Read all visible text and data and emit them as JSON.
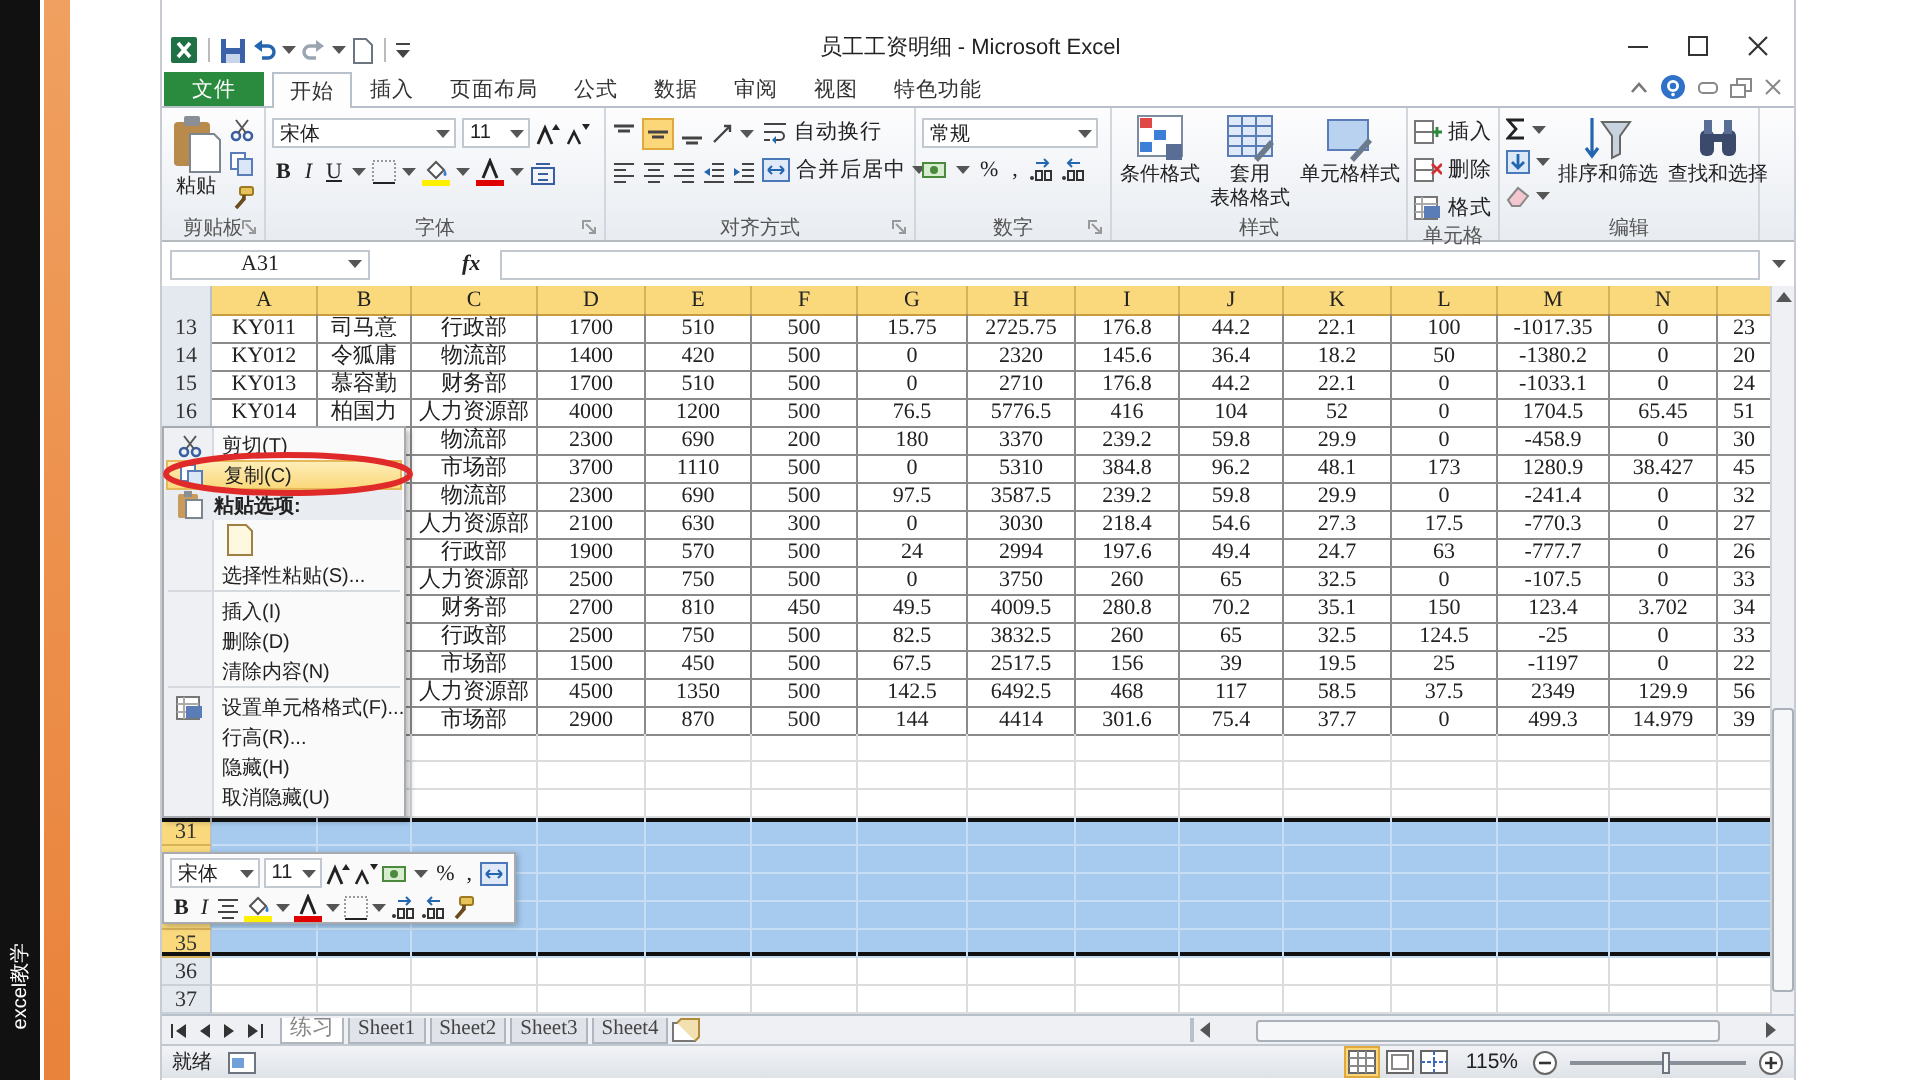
{
  "side_label": "excel教学",
  "window": {
    "title": "员工工资明细 - Microsoft Excel"
  },
  "ribbon_tabs": [
    {
      "label": "文件",
      "kind": "file",
      "selected": false
    },
    {
      "label": "开始",
      "kind": "tab",
      "selected": true
    },
    {
      "label": "插入",
      "kind": "tab",
      "selected": false
    },
    {
      "label": "页面布局",
      "kind": "tab",
      "selected": false
    },
    {
      "label": "公式",
      "kind": "tab",
      "selected": false
    },
    {
      "label": "数据",
      "kind": "tab",
      "selected": false
    },
    {
      "label": "审阅",
      "kind": "tab",
      "selected": false
    },
    {
      "label": "视图",
      "kind": "tab",
      "selected": false
    },
    {
      "label": "特色功能",
      "kind": "tab",
      "selected": false
    }
  ],
  "ribbon": {
    "clipboard": {
      "label": "剪贴板",
      "paste": "粘贴"
    },
    "font": {
      "label": "字体",
      "font_name": "宋体",
      "font_size": "11",
      "bold": "B",
      "italic": "I",
      "underline": "U"
    },
    "alignment": {
      "label": "对齐方式",
      "wrap": "自动换行",
      "merge": "合并后居中"
    },
    "number": {
      "label": "数字",
      "format": "常规",
      "percent": "%",
      "comma": ","
    },
    "styles": {
      "label": "样式",
      "buttons": [
        {
          "lines": [
            "条件格式"
          ]
        },
        {
          "lines": [
            "套用",
            "表格格式"
          ]
        },
        {
          "lines": [
            "单元格样式"
          ]
        }
      ]
    },
    "cells": {
      "label": "单元格",
      "items": [
        "插入",
        "删除",
        "格式"
      ]
    },
    "editing": {
      "label": "编辑",
      "buttons": [
        "排序和筛选",
        "查找和选择"
      ]
    }
  },
  "formula_bar": {
    "name_box": "A31",
    "fx": "fx"
  },
  "columns": [
    "A",
    "B",
    "C",
    "D",
    "E",
    "F",
    "G",
    "H",
    "I",
    "J",
    "K",
    "L",
    "M",
    "N"
  ],
  "rows": [
    {
      "number": "13",
      "selected": false,
      "cells": [
        "KY011",
        "司马意",
        "行政部",
        "1700",
        "510",
        "500",
        "15.75",
        "2725.75",
        "176.8",
        "44.2",
        "22.1",
        "100",
        "-1017.35",
        "0",
        "23"
      ]
    },
    {
      "number": "14",
      "selected": false,
      "cells": [
        "KY012",
        "令狐庸",
        "物流部",
        "1400",
        "420",
        "500",
        "0",
        "2320",
        "145.6",
        "36.4",
        "18.2",
        "50",
        "-1380.2",
        "0",
        "20"
      ]
    },
    {
      "number": "15",
      "selected": false,
      "cells": [
        "KY013",
        "慕容勤",
        "财务部",
        "1700",
        "510",
        "500",
        "0",
        "2710",
        "176.8",
        "44.2",
        "22.1",
        "0",
        "-1033.1",
        "0",
        "24"
      ]
    },
    {
      "number": "16",
      "selected": false,
      "cells": [
        "KY014",
        "柏国力",
        "人力资源部",
        "4000",
        "1200",
        "500",
        "76.5",
        "5776.5",
        "416",
        "104",
        "52",
        "0",
        "1704.5",
        "65.45",
        "51"
      ]
    },
    {
      "selected": false,
      "cells": [
        "物流部",
        "2300",
        "690",
        "200",
        "180",
        "3370",
        "239.2",
        "59.8",
        "29.9",
        "0",
        "-458.9",
        "0",
        "30"
      ]
    },
    {
      "selected": false,
      "cells": [
        "市场部",
        "3700",
        "1110",
        "500",
        "0",
        "5310",
        "384.8",
        "96.2",
        "48.1",
        "173",
        "1280.9",
        "38.427",
        "45"
      ]
    },
    {
      "selected": false,
      "cells": [
        "物流部",
        "2300",
        "690",
        "500",
        "97.5",
        "3587.5",
        "239.2",
        "59.8",
        "29.9",
        "0",
        "-241.4",
        "0",
        "32"
      ]
    },
    {
      "selected": false,
      "cells": [
        "人力资源部",
        "2100",
        "630",
        "300",
        "0",
        "3030",
        "218.4",
        "54.6",
        "27.3",
        "17.5",
        "-770.3",
        "0",
        "27"
      ]
    },
    {
      "selected": false,
      "cells": [
        "行政部",
        "1900",
        "570",
        "500",
        "24",
        "2994",
        "197.6",
        "49.4",
        "24.7",
        "63",
        "-777.7",
        "0",
        "26"
      ]
    },
    {
      "selected": false,
      "cells": [
        "人力资源部",
        "2500",
        "750",
        "500",
        "0",
        "3750",
        "260",
        "65",
        "32.5",
        "0",
        "-107.5",
        "0",
        "33"
      ]
    },
    {
      "selected": false,
      "cells": [
        "财务部",
        "2700",
        "810",
        "450",
        "49.5",
        "4009.5",
        "280.8",
        "70.2",
        "35.1",
        "150",
        "123.4",
        "3.702",
        "34"
      ]
    },
    {
      "selected": false,
      "cells": [
        "行政部",
        "2500",
        "750",
        "500",
        "82.5",
        "3832.5",
        "260",
        "65",
        "32.5",
        "124.5",
        "-25",
        "0",
        "33"
      ]
    },
    {
      "selected": false,
      "cells": [
        "市场部",
        "1500",
        "450",
        "500",
        "67.5",
        "2517.5",
        "156",
        "39",
        "19.5",
        "25",
        "-1197",
        "0",
        "22"
      ]
    },
    {
      "selected": false,
      "cells": [
        "人力资源部",
        "4500",
        "1350",
        "500",
        "142.5",
        "6492.5",
        "468",
        "117",
        "58.5",
        "37.5",
        "2349",
        "129.9",
        "56"
      ]
    },
    {
      "selected": false,
      "cells": [
        "市场部",
        "2900",
        "870",
        "500",
        "144",
        "4414",
        "301.6",
        "75.4",
        "37.7",
        "0",
        "499.3",
        "14.979",
        "39"
      ]
    },
    {
      "selected": false
    },
    {
      "selected": false
    },
    {
      "selected": false
    },
    {
      "number": "31",
      "selected": true
    },
    {
      "selected": true
    },
    {
      "selected": true
    },
    {
      "selected": true
    },
    {
      "number": "35",
      "selected": true
    },
    {
      "number": "36",
      "selected": false
    },
    {
      "number": "37",
      "selected": false
    }
  ],
  "context_menu": [
    {
      "kind": "cut",
      "label": "剪切(T)",
      "selected": false
    },
    {
      "kind": "copy",
      "label": "复制(C)",
      "selected": true
    },
    {
      "kind": "header",
      "label": "粘贴选项:",
      "selected": false
    },
    {
      "kind": "paste_button",
      "selected": false
    },
    {
      "kind": "item",
      "label": "选择性粘贴(S)...",
      "selected": false,
      "divider_below": true
    },
    {
      "kind": "item",
      "label": "插入(I)",
      "selected": false
    },
    {
      "kind": "item",
      "label": "删除(D)",
      "selected": false
    },
    {
      "kind": "item",
      "label": "清除内容(N)",
      "selected": false,
      "divider_below": true
    },
    {
      "kind": "format",
      "label": "设置单元格格式(F)...",
      "selected": false
    },
    {
      "kind": "item",
      "label": "行高(R)...",
      "selected": false
    },
    {
      "kind": "item",
      "label": "隐藏(H)",
      "selected": false
    },
    {
      "kind": "item",
      "label": "取消隐藏(U)",
      "selected": false
    }
  ],
  "mini_toolbar": {
    "font_name": "宋体",
    "font_size": "11",
    "percent": "%",
    "comma": ",",
    "bold": "B",
    "italic": "I"
  },
  "sheet_tabs": [
    {
      "label": "练习",
      "selected": true
    },
    {
      "label": "Sheet1",
      "selected": false
    },
    {
      "label": "Sheet2",
      "selected": false
    },
    {
      "label": "Sheet3",
      "selected": false
    },
    {
      "label": "Sheet4",
      "selected": false
    }
  ],
  "status_bar": {
    "status": "就绪",
    "zoom": "115%",
    "zoom_slider": {
      "level": 0.55
    }
  }
}
